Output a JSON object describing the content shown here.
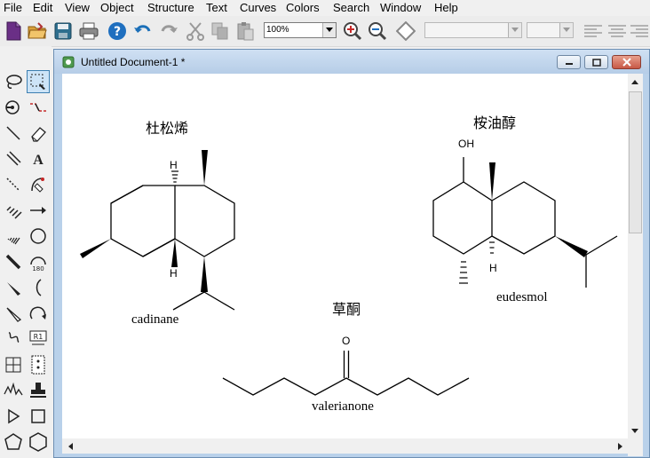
{
  "menu": [
    "File",
    "Edit",
    "View",
    "Object",
    "Structure",
    "Text",
    "Curves",
    "Colors",
    "Search",
    "Window",
    "Help"
  ],
  "toolbar": {
    "zoom_value": "100%",
    "font_value": "",
    "size_value": ""
  },
  "document": {
    "title": "Untitled Document-1 *"
  },
  "molecules": {
    "cadinane": {
      "chinese": "杜松烯",
      "name": "cadinane",
      "atom_h_top": "H",
      "atom_h_bottom": "H"
    },
    "eudesmol": {
      "chinese": "桉油醇",
      "name": "eudesmol",
      "atom_oh": "OH",
      "atom_h": "H"
    },
    "valerianone": {
      "chinese": "草酮",
      "name": "valerianone",
      "atom_o": "O"
    }
  },
  "colors": {
    "titlebar": "#c4d9ef",
    "accent": "#3c7fb1"
  }
}
